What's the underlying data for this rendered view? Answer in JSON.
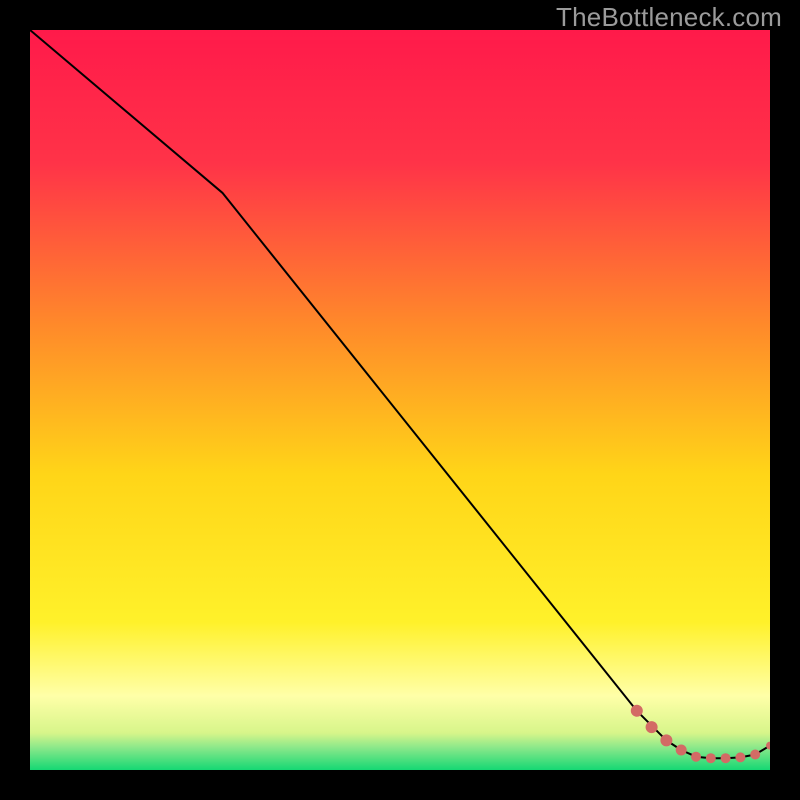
{
  "watermark": "TheBottleneck.com",
  "colors": {
    "frame": "#000000",
    "watermark": "#9b9b9b",
    "line": "#000000",
    "marker": "#d36b65",
    "gradient_top": "#ff1a4a",
    "gradient_mid1": "#ff7a2a",
    "gradient_mid2": "#ffe500",
    "gradient_low": "#ffffb0",
    "gradient_bottom": "#1ee07a"
  },
  "chart_data": {
    "type": "line",
    "title": "",
    "xlabel": "",
    "ylabel": "",
    "xlim": [
      0,
      100
    ],
    "ylim": [
      0,
      100
    ],
    "series": [
      {
        "name": "curve",
        "x": [
          0,
          26,
          82,
          86,
          88,
          90,
          92,
          94,
          96,
          98,
          100
        ],
        "y": [
          100,
          78,
          8,
          4,
          2.7,
          1.8,
          1.6,
          1.6,
          1.7,
          2.1,
          3.3
        ]
      }
    ],
    "markers": {
      "name": "highlight-points",
      "x": [
        82,
        84,
        86,
        88,
        90,
        92,
        94,
        96,
        98,
        100
      ],
      "y": [
        8,
        5.8,
        4,
        2.7,
        1.8,
        1.6,
        1.6,
        1.7,
        2.1,
        3.3
      ],
      "radius": [
        6,
        6,
        6,
        5.5,
        5,
        5,
        5,
        5,
        5,
        4
      ]
    }
  }
}
